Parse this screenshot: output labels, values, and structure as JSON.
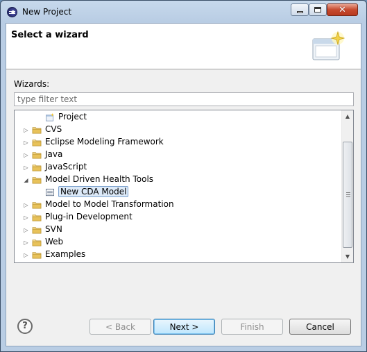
{
  "window": {
    "title": "New Project"
  },
  "header": {
    "title": "Select a wizard",
    "banner_icon": "new-wizard-icon"
  },
  "filter": {
    "label": "Wizards:",
    "placeholder": "type filter text",
    "value": ""
  },
  "tree": {
    "items": [
      {
        "label": "Project",
        "depth": 1,
        "expandable": false,
        "expanded": false,
        "icon": "project-icon",
        "selected": false
      },
      {
        "label": "CVS",
        "depth": 0,
        "expandable": true,
        "expanded": false,
        "icon": "folder-icon",
        "selected": false
      },
      {
        "label": "Eclipse Modeling Framework",
        "depth": 0,
        "expandable": true,
        "expanded": false,
        "icon": "folder-icon",
        "selected": false
      },
      {
        "label": "Java",
        "depth": 0,
        "expandable": true,
        "expanded": false,
        "icon": "folder-icon",
        "selected": false
      },
      {
        "label": "JavaScript",
        "depth": 0,
        "expandable": true,
        "expanded": false,
        "icon": "folder-icon",
        "selected": false
      },
      {
        "label": "Model Driven Health Tools",
        "depth": 0,
        "expandable": true,
        "expanded": true,
        "icon": "folder-icon",
        "selected": false
      },
      {
        "label": "New CDA Model",
        "depth": 1,
        "expandable": false,
        "expanded": false,
        "icon": "model-icon",
        "selected": true
      },
      {
        "label": "Model to Model Transformation",
        "depth": 0,
        "expandable": true,
        "expanded": false,
        "icon": "folder-icon",
        "selected": false
      },
      {
        "label": "Plug-in Development",
        "depth": 0,
        "expandable": true,
        "expanded": false,
        "icon": "folder-icon",
        "selected": false
      },
      {
        "label": "SVN",
        "depth": 0,
        "expandable": true,
        "expanded": false,
        "icon": "folder-icon",
        "selected": false
      },
      {
        "label": "Web",
        "depth": 0,
        "expandable": true,
        "expanded": false,
        "icon": "folder-icon",
        "selected": false
      },
      {
        "label": "Examples",
        "depth": 0,
        "expandable": true,
        "expanded": false,
        "icon": "folder-icon",
        "selected": false
      }
    ]
  },
  "buttons": {
    "help_glyph": "?",
    "back": "< Back",
    "next": "Next >",
    "finish": "Finish",
    "cancel": "Cancel"
  },
  "colors": {
    "folder": "#e8c25a",
    "selection": "#dce9f7",
    "default_button": "#bee6fd"
  }
}
